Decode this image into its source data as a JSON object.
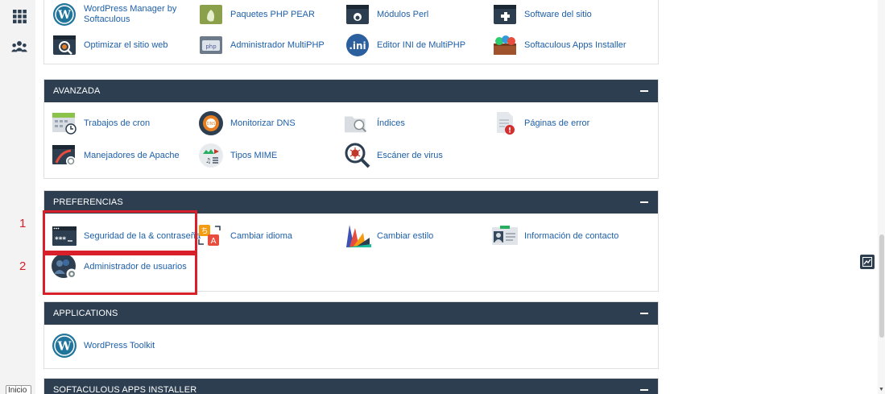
{
  "left_sidebar": {
    "icons": [
      "apps-grid-icon",
      "users-icon"
    ],
    "home_label": "Inicio"
  },
  "top_section": {
    "items": [
      {
        "label": "WordPress Manager by Softaculous",
        "icon": "wordpress-icon"
      },
      {
        "label": "Paquetes PHP PEAR",
        "icon": "php-pear-icon"
      },
      {
        "label": "Módulos Perl",
        "icon": "perl-module-icon"
      },
      {
        "label": "Software del sitio",
        "icon": "site-software-icon"
      },
      {
        "label": "Optimizar el sitio web",
        "icon": "optimize-website-icon"
      },
      {
        "label": "Administrador MultiPHP",
        "icon": "multiphp-manager-icon"
      },
      {
        "label": "Editor INI de MultiPHP",
        "icon": "ini-editor-icon"
      },
      {
        "label": "Softaculous Apps Installer",
        "icon": "softaculous-icon"
      }
    ]
  },
  "sections": [
    {
      "title": "Avanzada",
      "items": [
        {
          "label": "Trabajos de cron",
          "icon": "cron-jobs-icon"
        },
        {
          "label": "Monitorizar DNS",
          "icon": "dns-monitor-icon"
        },
        {
          "label": "Índices",
          "icon": "indexes-icon"
        },
        {
          "label": "Páginas de error",
          "icon": "error-pages-icon"
        },
        {
          "label": "Manejadores de Apache",
          "icon": "apache-handlers-icon"
        },
        {
          "label": "Tipos MIME",
          "icon": "mime-types-icon"
        },
        {
          "label": "Escáner de virus",
          "icon": "virus-scanner-icon"
        }
      ]
    },
    {
      "title": "Preferencias",
      "items": [
        {
          "label": "Seguridad de la & contraseña",
          "icon": "password-security-icon"
        },
        {
          "label": "Cambiar idioma",
          "icon": "change-language-icon"
        },
        {
          "label": "Cambiar estilo",
          "icon": "change-style-icon"
        },
        {
          "label": "Información de contacto",
          "icon": "contact-info-icon"
        },
        {
          "label": "Administrador de usuarios",
          "icon": "user-manager-icon"
        }
      ]
    },
    {
      "title": "Applications",
      "items": [
        {
          "label": "WordPress Toolkit",
          "icon": "wordpress-icon"
        }
      ]
    },
    {
      "title": "Softaculous Apps Installer",
      "items": []
    }
  ],
  "annotations": {
    "marker_1": "1",
    "marker_2": "2",
    "color": "#d9202a"
  },
  "colors": {
    "section_header_bg": "#2c3e50",
    "link": "#1e5fa8"
  }
}
